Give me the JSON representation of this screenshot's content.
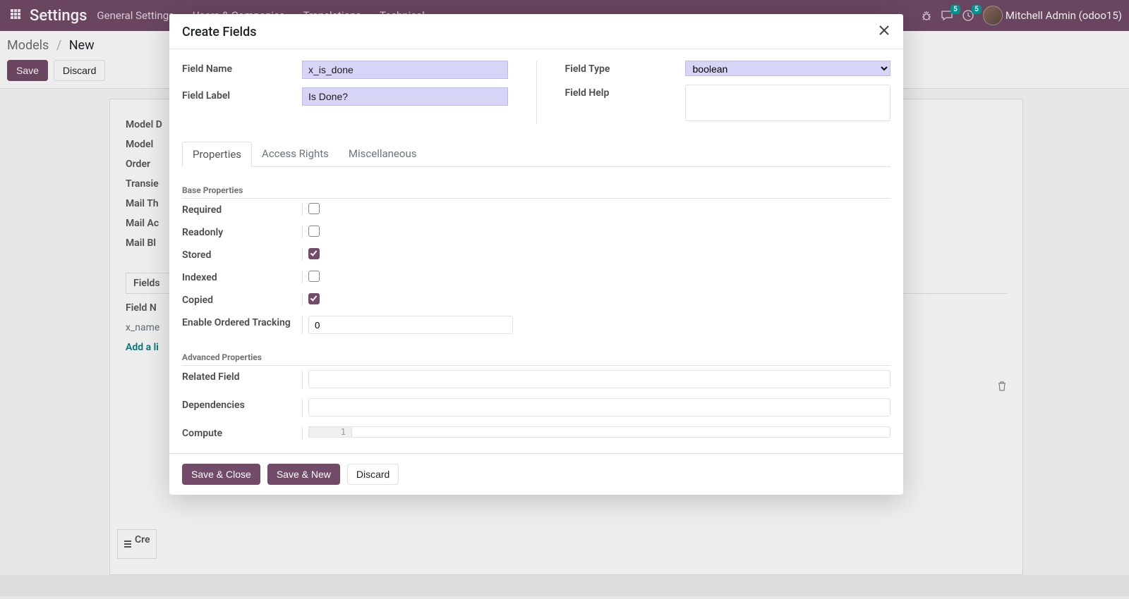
{
  "header": {
    "brand": "Settings",
    "badge1": "5",
    "badge2": "5",
    "user": "Mitchell Admin (odoo15)"
  },
  "nav": {
    "items": [
      "General Settings",
      "Users & Companies",
      "Translations",
      "Technical"
    ]
  },
  "breadcrumb": {
    "parent": "Models",
    "current": "New",
    "separator": "/"
  },
  "actions": {
    "save": "Save",
    "discard": "Discard"
  },
  "background_form": {
    "labels": [
      "Model D",
      "Model",
      "Order",
      "Transie",
      "Mail Th",
      "Mail Ac",
      "Mail Bl"
    ],
    "fields_tab": "Fields",
    "col_header": "Field N",
    "row_value": "x_name",
    "add_line": "Add a li",
    "bottom_btn": "Cre"
  },
  "modal": {
    "title": "Create Fields",
    "labels": {
      "field_name": "Field Name",
      "field_label": "Field Label",
      "field_type": "Field Type",
      "field_help": "Field Help"
    },
    "values": {
      "field_name": "x_is_done",
      "field_label": "Is Done?",
      "field_type": "boolean",
      "field_help": ""
    },
    "tabs": [
      "Properties",
      "Access Rights",
      "Miscellaneous"
    ],
    "section_base": "Base Properties",
    "base_props": {
      "required": {
        "label": "Required",
        "checked": false
      },
      "readonly": {
        "label": "Readonly",
        "checked": false
      },
      "stored": {
        "label": "Stored",
        "checked": true
      },
      "indexed": {
        "label": "Indexed",
        "checked": false
      },
      "copied": {
        "label": "Copied",
        "checked": true
      },
      "tracking": {
        "label": "Enable Ordered Tracking",
        "value": "0"
      }
    },
    "section_adv": "Advanced Properties",
    "adv_props": {
      "related": {
        "label": "Related Field",
        "value": ""
      },
      "deps": {
        "label": "Dependencies",
        "value": ""
      },
      "compute": {
        "label": "Compute",
        "gutter": "1",
        "value": ""
      }
    },
    "footer": {
      "save_close": "Save & Close",
      "save_new": "Save & New",
      "discard": "Discard"
    }
  }
}
